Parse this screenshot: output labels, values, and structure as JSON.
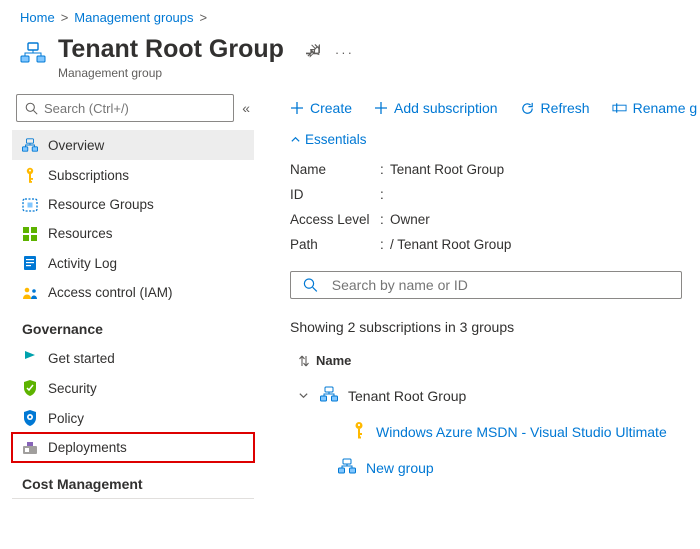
{
  "breadcrumb": {
    "home": "Home",
    "management_groups": "Management groups"
  },
  "header": {
    "title": "Tenant Root Group",
    "subtitle": "Management group"
  },
  "sidebar": {
    "search_placeholder": "Search (Ctrl+/)",
    "items": {
      "overview": "Overview",
      "subscriptions": "Subscriptions",
      "resource_groups": "Resource Groups",
      "resources": "Resources",
      "activity_log": "Activity Log",
      "access_control": "Access control (IAM)"
    },
    "governance_title": "Governance",
    "governance": {
      "get_started": "Get started",
      "security": "Security",
      "policy": "Policy",
      "deployments": "Deployments"
    },
    "cost_title": "Cost Management"
  },
  "toolbar": {
    "create": "Create",
    "add_subscription": "Add subscription",
    "refresh": "Refresh",
    "rename": "Rename g"
  },
  "essentials": {
    "header": "Essentials",
    "rows": {
      "name_k": "Name",
      "name_v": "Tenant Root Group",
      "id_k": "ID",
      "id_v": "",
      "access_k": "Access Level",
      "access_v": "Owner",
      "path_k": "Path",
      "path_v": "/ Tenant Root Group"
    }
  },
  "main_search_placeholder": "Search by name or ID",
  "showing_text": "Showing 2 subscriptions in 3 groups",
  "column_header": "Name",
  "tree": {
    "root": "Tenant Root Group",
    "sub1": "Windows Azure MSDN - Visual Studio Ultimate",
    "group1": "New group"
  }
}
